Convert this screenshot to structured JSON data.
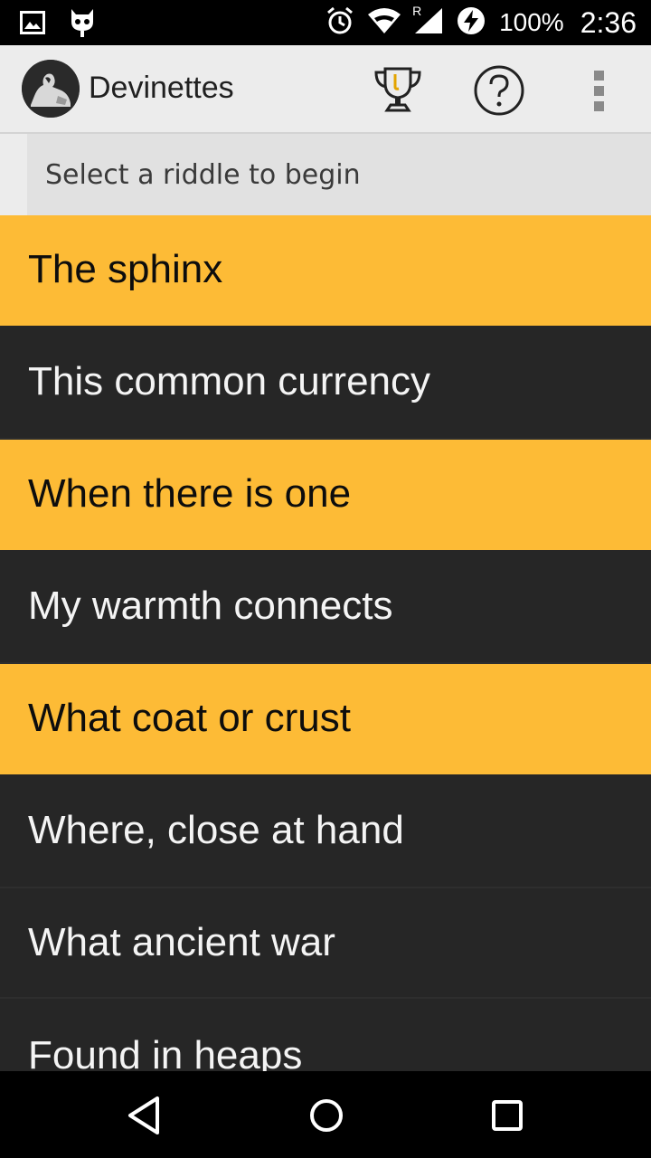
{
  "status_bar": {
    "battery": "100%",
    "time": "2:36",
    "signal_label": "R"
  },
  "action_bar": {
    "title": "Devinettes"
  },
  "hint": "Select a riddle to begin",
  "riddles": [
    "The sphinx",
    "This common currency",
    "When there is one",
    "My warmth connects",
    "What coat or crust",
    "Where, close at hand",
    "What ancient war",
    "Found in heaps"
  ],
  "colors": {
    "gold": "#fdbb36",
    "dark": "#262626",
    "action_bar": "#ececec"
  },
  "icons": {
    "status_left": [
      "image-icon",
      "cyanogen-icon"
    ],
    "status_right": [
      "alarm-icon",
      "wifi-icon",
      "signal-icon",
      "battery-charging-icon"
    ],
    "action": [
      "trophy-icon",
      "help-icon",
      "overflow-icon"
    ],
    "nav": [
      "back-icon",
      "home-icon",
      "recents-icon"
    ]
  }
}
